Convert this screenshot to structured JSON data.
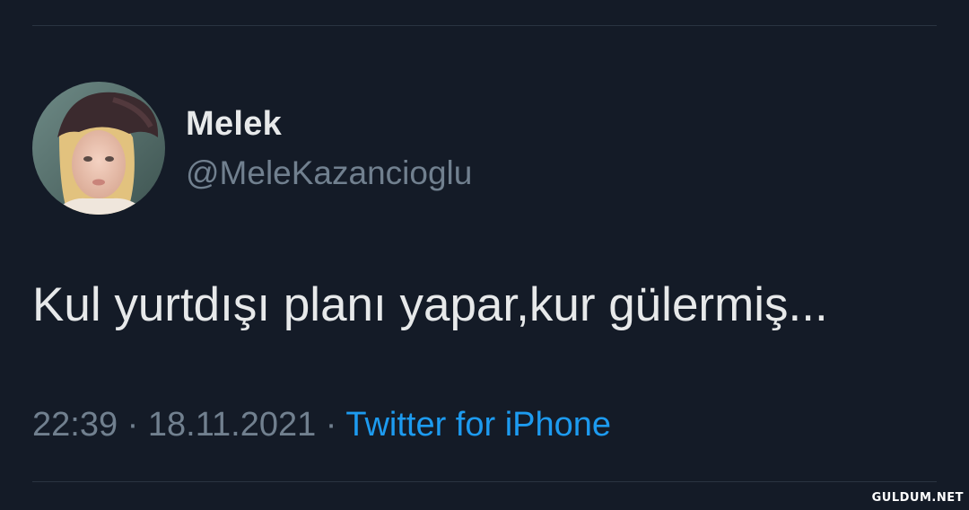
{
  "colors": {
    "background": "#141b27",
    "primary_text": "#e7e9ea",
    "secondary_text": "#71808f",
    "link": "#1d9bf0",
    "divider": "#2a3441"
  },
  "user": {
    "display_name": "Melek",
    "handle": "@MeleKazancioglu",
    "avatar_icon": "profile-photo"
  },
  "tweet": {
    "text": "Kul yurtdışı planı yapar,kur gülermiş..."
  },
  "meta": {
    "time": "22:39",
    "separator": " · ",
    "date": "18.11.2021",
    "source": "Twitter for iPhone"
  },
  "watermark": "GULDUM.NET"
}
